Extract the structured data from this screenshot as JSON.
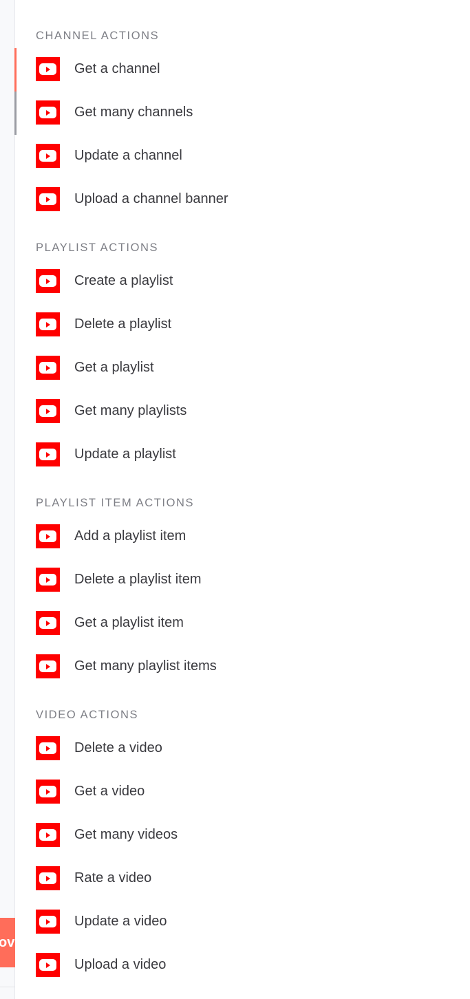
{
  "left_strip": {
    "floating_button_label": "ov"
  },
  "sections": [
    {
      "title": "CHANNEL ACTIONS",
      "items": [
        "Get a channel",
        "Get many channels",
        "Update a channel",
        "Upload a channel banner"
      ]
    },
    {
      "title": "PLAYLIST ACTIONS",
      "items": [
        "Create a playlist",
        "Delete a playlist",
        "Get a playlist",
        "Get many playlists",
        "Update a playlist"
      ]
    },
    {
      "title": "PLAYLIST ITEM ACTIONS",
      "items": [
        "Add a playlist item",
        "Delete a playlist item",
        "Get a playlist item",
        "Get many playlist items"
      ]
    },
    {
      "title": "VIDEO ACTIONS",
      "items": [
        "Delete a video",
        "Get a video",
        "Get many videos",
        "Rate a video",
        "Update a video",
        "Upload a video"
      ]
    }
  ],
  "icon": "youtube-icon",
  "colors": {
    "accent": "#ff6d5a",
    "youtube_red": "#ff0000",
    "section_title": "#7e7f86",
    "text": "#3a3a3f"
  }
}
